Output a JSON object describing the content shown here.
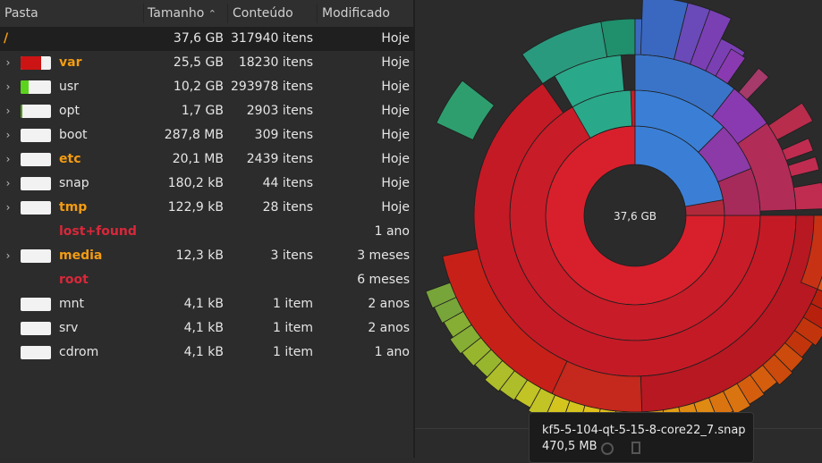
{
  "header": {
    "col_folder": "Pasta",
    "col_size": "Tamanho",
    "col_content": "Conteúdo",
    "col_modified": "Modificado",
    "sort_icon": "chevron-up-icon"
  },
  "root_row": {
    "name": "/",
    "size": "37,6 GB",
    "items": "317940 itens",
    "modified": "Hoje"
  },
  "rows": [
    {
      "name": "var",
      "size": "25,5 GB",
      "items": "18230 itens",
      "modified": "Hoje",
      "expandable": true,
      "bar_fraction": 0.68,
      "bar_color": "#cc1414",
      "style": "bold-orange",
      "show_bar": true
    },
    {
      "name": "usr",
      "size": "10,2 GB",
      "items": "293978 itens",
      "modified": "Hoje",
      "expandable": true,
      "bar_fraction": 0.27,
      "bar_color": "#5bd31c",
      "style": "normal",
      "show_bar": true
    },
    {
      "name": "opt",
      "size": "1,7 GB",
      "items": "2903 itens",
      "modified": "Hoje",
      "expandable": true,
      "bar_fraction": 0.05,
      "bar_color": "#4f9a1a",
      "style": "normal",
      "show_bar": true
    },
    {
      "name": "boot",
      "size": "287,8 MB",
      "items": "309 itens",
      "modified": "Hoje",
      "expandable": true,
      "bar_fraction": 0.0,
      "bar_color": "#cccccc",
      "style": "normal",
      "show_bar": true
    },
    {
      "name": "etc",
      "size": "20,1 MB",
      "items": "2439 itens",
      "modified": "Hoje",
      "expandable": true,
      "bar_fraction": 0.0,
      "bar_color": "#cccccc",
      "style": "bold-orange",
      "show_bar": true
    },
    {
      "name": "snap",
      "size": "180,2 kB",
      "items": "44 itens",
      "modified": "Hoje",
      "expandable": true,
      "bar_fraction": 0.0,
      "bar_color": "#cccccc",
      "style": "normal",
      "show_bar": true
    },
    {
      "name": "tmp",
      "size": "122,9 kB",
      "items": "28 itens",
      "modified": "Hoje",
      "expandable": true,
      "bar_fraction": 0.0,
      "bar_color": "#cccccc",
      "style": "bold-orange",
      "show_bar": true
    },
    {
      "name": "lost+found",
      "size": "",
      "items": "",
      "modified": "1 ano",
      "expandable": false,
      "bar_fraction": 0.0,
      "bar_color": "#cccccc",
      "style": "bold-red",
      "show_bar": false
    },
    {
      "name": "media",
      "size": "12,3 kB",
      "items": "3 itens",
      "modified": "3 meses",
      "expandable": true,
      "bar_fraction": 0.0,
      "bar_color": "#cccccc",
      "style": "bold-orange",
      "show_bar": true
    },
    {
      "name": "root",
      "size": "",
      "items": "",
      "modified": "6 meses",
      "expandable": false,
      "bar_fraction": 0.0,
      "bar_color": "#cccccc",
      "style": "bold-red",
      "show_bar": false
    },
    {
      "name": "mnt",
      "size": "4,1 kB",
      "items": "1 item",
      "modified": "2 anos",
      "expandable": false,
      "bar_fraction": 0.0,
      "bar_color": "#cccccc",
      "style": "normal",
      "show_bar": true
    },
    {
      "name": "srv",
      "size": "4,1 kB",
      "items": "1 item",
      "modified": "2 anos",
      "expandable": false,
      "bar_fraction": 0.0,
      "bar_color": "#cccccc",
      "style": "normal",
      "show_bar": true
    },
    {
      "name": "cdrom",
      "size": "4,1 kB",
      "items": "1 item",
      "modified": "1 ano",
      "expandable": false,
      "bar_fraction": 0.0,
      "bar_color": "#cccccc",
      "style": "normal",
      "show_bar": true
    }
  ],
  "ring_chart": {
    "center_label": "37,6 GB",
    "colors": {
      "var": "#d8202c",
      "usr": "#3a7fd5",
      "opt": "#2aa88a",
      "snap_green": "#2e9e6e",
      "tmp_pink": "#c2305a",
      "purple": "#7b3fb4"
    }
  },
  "tooltip": {
    "name": "kf5-5-104-qt-5-15-8-core22_7.snap",
    "size": "470,5 MB"
  },
  "icons": {
    "expander": "chevron-right-icon"
  }
}
